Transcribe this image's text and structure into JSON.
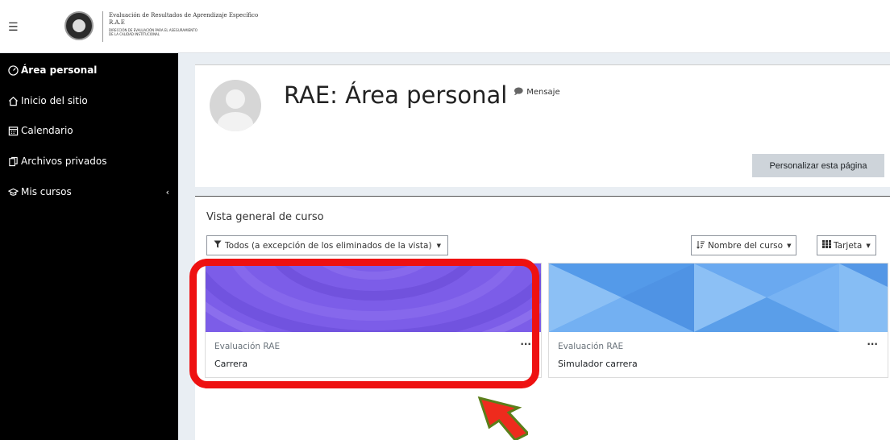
{
  "navbar": {
    "brand_title": "Evaluación de Resultados de Aprendizaje Específico",
    "brand_subtitle": "R.A.E",
    "brand_line3": "DIRECCIÓN DE EVALUACIÓN PARA EL ASEGURAMIENTO",
    "brand_line4": "DE LA CALIDAD INSTITUCIONAL"
  },
  "sidebar": {
    "items": [
      {
        "label": "Área personal",
        "icon": "dashboard-icon",
        "active": true
      },
      {
        "label": "Inicio del sitio",
        "icon": "home-icon"
      },
      {
        "label": "Calendario",
        "icon": "calendar-icon"
      },
      {
        "label": "Archivos privados",
        "icon": "files-icon"
      },
      {
        "label": "Mis cursos",
        "icon": "graduation-cap-icon"
      }
    ]
  },
  "header": {
    "title": "RAE: Área personal",
    "message_label": "Mensaje",
    "customize_label": "Personalizar esta página"
  },
  "courses": {
    "section_title": "Vista general de curso",
    "filter_label": "Todos (a excepción de los eliminados de la vista)",
    "sort_label": "Nombre del curso",
    "view_label": "Tarjeta",
    "cards": [
      {
        "category": "Evaluación RAE",
        "name": "Carrera",
        "color": "#7a5ae6"
      },
      {
        "category": "Evaluación RAE",
        "name": "Simulador carrera",
        "color": "#5ea0ee"
      }
    ]
  },
  "colors": {
    "highlight": "#ee1111",
    "arrow_fill": "#ee2b1d",
    "arrow_stroke": "#5a7f1a"
  }
}
